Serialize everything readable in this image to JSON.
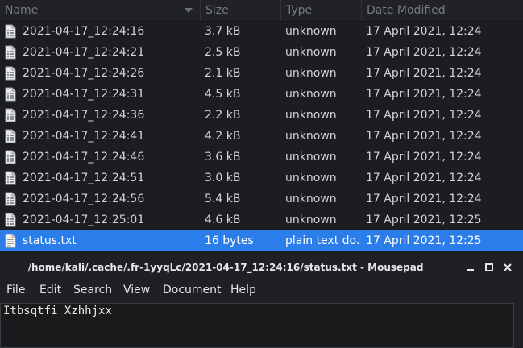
{
  "file_manager": {
    "columns": {
      "name": "Name",
      "size": "Size",
      "type": "Type",
      "date": "Date Modified"
    },
    "files": [
      {
        "name": "2021-04-17_12:24:16",
        "size": "3.7 kB",
        "type": "unknown",
        "date": "17 April 2021, 12:24",
        "icon": "file-icon",
        "selected": false
      },
      {
        "name": "2021-04-17_12:24:21",
        "size": "2.5 kB",
        "type": "unknown",
        "date": "17 April 2021, 12:24",
        "icon": "file-icon",
        "selected": false
      },
      {
        "name": "2021-04-17_12:24:26",
        "size": "2.1 kB",
        "type": "unknown",
        "date": "17 April 2021, 12:24",
        "icon": "file-icon",
        "selected": false
      },
      {
        "name": "2021-04-17_12:24:31",
        "size": "4.5 kB",
        "type": "unknown",
        "date": "17 April 2021, 12:24",
        "icon": "file-icon",
        "selected": false
      },
      {
        "name": "2021-04-17_12:24:36",
        "size": "2.2 kB",
        "type": "unknown",
        "date": "17 April 2021, 12:24",
        "icon": "file-icon",
        "selected": false
      },
      {
        "name": "2021-04-17_12:24:41",
        "size": "4.2 kB",
        "type": "unknown",
        "date": "17 April 2021, 12:24",
        "icon": "file-icon",
        "selected": false
      },
      {
        "name": "2021-04-17_12:24:46",
        "size": "3.6 kB",
        "type": "unknown",
        "date": "17 April 2021, 12:24",
        "icon": "file-icon",
        "selected": false
      },
      {
        "name": "2021-04-17_12:24:51",
        "size": "3.0 kB",
        "type": "unknown",
        "date": "17 April 2021, 12:24",
        "icon": "file-icon",
        "selected": false
      },
      {
        "name": "2021-04-17_12:24:56",
        "size": "5.4 kB",
        "type": "unknown",
        "date": "17 April 2021, 12:24",
        "icon": "file-icon",
        "selected": false
      },
      {
        "name": "2021-04-17_12:25:01",
        "size": "4.6 kB",
        "type": "unknown",
        "date": "17 April 2021, 12:25",
        "icon": "file-icon",
        "selected": false
      },
      {
        "name": "status.txt",
        "size": "16 bytes",
        "type": "plain text do...",
        "date": "17 April 2021, 12:25",
        "icon": "text-file-icon",
        "selected": true
      }
    ],
    "colors": {
      "selection": "#2b7de9",
      "background": "#1b1d20",
      "text": "#d2d4d7"
    }
  },
  "mousepad": {
    "title": "/home/kali/.cache/.fr-1yyqLc/2021-04-17_12:24:16/status.txt - Mousepad",
    "window_buttons": [
      "minimize-icon",
      "maximize-icon",
      "close-icon"
    ],
    "menu": [
      "File",
      "Edit",
      "Search",
      "View",
      "Document",
      "Help"
    ],
    "editor_text": "Itbsqtfi Xzhhjxx"
  }
}
